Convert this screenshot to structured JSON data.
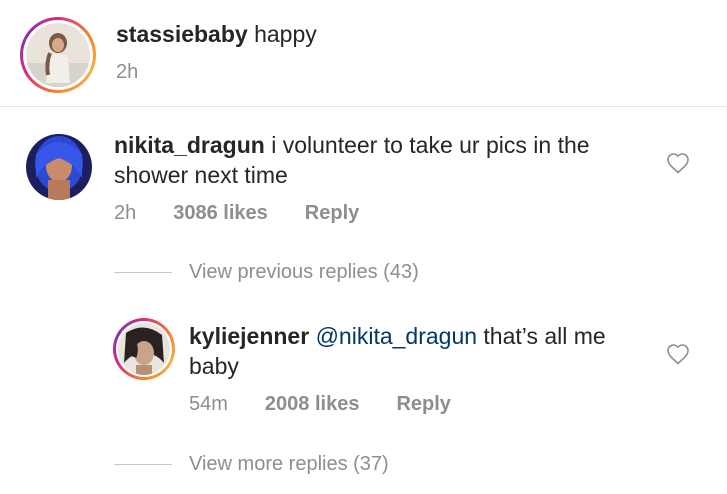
{
  "caption": {
    "username": "stassiebaby",
    "text": "happy",
    "time": "2h"
  },
  "comment": {
    "username": "nikita_dragun",
    "text": "i volunteer to take ur pics in the shower next time",
    "time": "2h",
    "likes": "3086 likes",
    "reply_label": "Reply",
    "view_previous": "View previous replies (43)"
  },
  "reply": {
    "username": "kyliejenner",
    "mention": "@nikita_dragun",
    "text": "that’s all me baby",
    "time": "54m",
    "likes": "2008 likes",
    "reply_label": "Reply",
    "view_more": "View more replies (37)"
  },
  "colors": {
    "text": "#262626",
    "muted": "#8e8e8e",
    "mention": "#00376b",
    "divider": "#e6e6e6"
  },
  "icons": {
    "like": "heart-outline-icon"
  }
}
